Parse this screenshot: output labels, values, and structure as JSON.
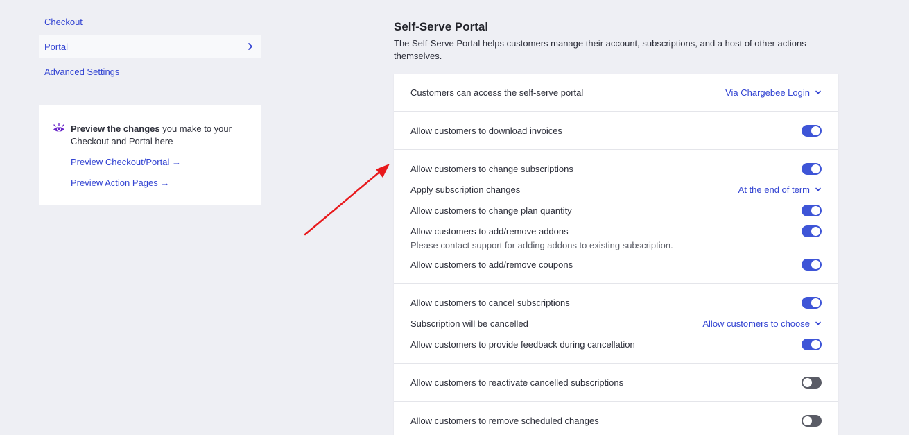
{
  "nav": {
    "items": [
      {
        "label": "Checkout"
      },
      {
        "label": "Portal"
      },
      {
        "label": "Advanced Settings"
      }
    ]
  },
  "preview": {
    "bold": "Preview the changes",
    "rest": " you make to your Checkout and Portal here",
    "link1": "Preview Checkout/Portal →",
    "link2": "Preview Action Pages →"
  },
  "page": {
    "title": "Self-Serve Portal",
    "description": "The Self-Serve Portal helps customers manage their account, subscriptions, and a host of other actions themselves."
  },
  "settings": {
    "access_label": "Customers can access the self-serve portal",
    "access_value": "Via Chargebee Login",
    "download_label": "Allow customers to download invoices",
    "download_on": true,
    "change_subs_label": "Allow customers to change subscriptions",
    "change_subs_on": true,
    "apply_changes_label": "Apply subscription changes",
    "apply_changes_value": "At the end of term",
    "plan_qty_label": "Allow customers to change plan quantity",
    "plan_qty_on": true,
    "addons_label": "Allow customers to add/remove addons",
    "addons_on": true,
    "addons_note": "Please contact support for adding addons to existing subscription.",
    "coupons_label": "Allow customers to add/remove coupons",
    "coupons_on": true,
    "cancel_label": "Allow customers to cancel subscriptions",
    "cancel_on": true,
    "cancel_when_label": "Subscription will be cancelled",
    "cancel_when_value": "Allow customers to choose",
    "feedback_label": "Allow customers to provide feedback during cancellation",
    "feedback_on": true,
    "reactivate_label": "Allow customers to reactivate cancelled subscriptions",
    "reactivate_on": false,
    "remove_scheduled_label": "Allow customers to remove scheduled changes",
    "remove_scheduled_on": false
  },
  "colors": {
    "accent": "#3344d2",
    "toggle_on": "#3e55d7",
    "toggle_off": "#5a5c66",
    "annotation_arrow": "#e8191c"
  }
}
